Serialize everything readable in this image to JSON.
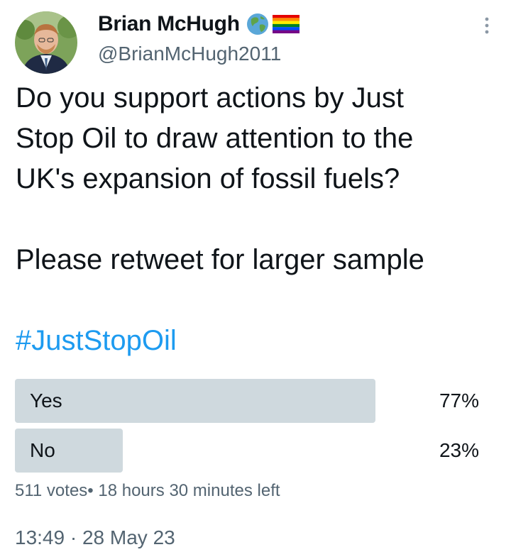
{
  "author": {
    "display_name": "Brian McHugh",
    "handle": "@BrianMcHugh2011",
    "avatar_icon": "profile-photo",
    "badges": [
      "globe-icon",
      "rainbow-flag-icon"
    ]
  },
  "menu": {
    "icon": "more-vertical-icon"
  },
  "tweet": {
    "line1": "Do you support actions by Just",
    "line2": "Stop Oil to draw attention to the",
    "line3": "UK's expansion of fossil fuels?",
    "line4": "Please retweet for larger sample",
    "hashtag": "#JustStopOil"
  },
  "poll": {
    "options": [
      {
        "label": "Yes",
        "percent_text": "77%",
        "percent": 77
      },
      {
        "label": "No",
        "percent_text": "23%",
        "percent": 23
      }
    ],
    "votes": "511 votes",
    "separator": "•",
    "time_left": "18 hours 30 minutes left"
  },
  "meta": {
    "time": "13:49",
    "dot": "·",
    "date": "28 May 23"
  },
  "colors": {
    "text": "#0f1419",
    "secondary": "#536471",
    "link": "#1d9bf0",
    "poll_bar": "#cfd9de"
  }
}
